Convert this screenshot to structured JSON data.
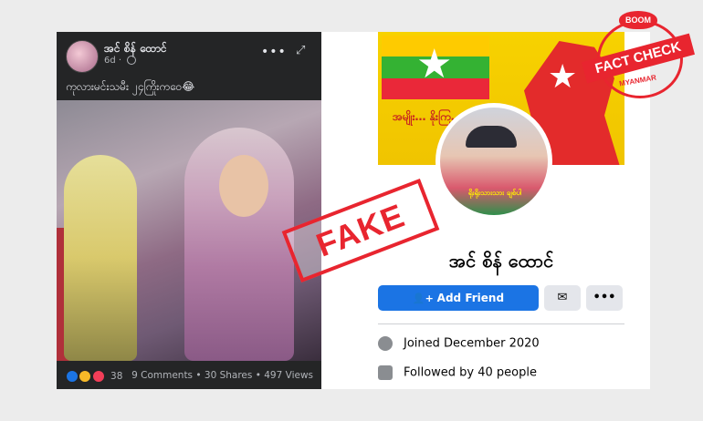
{
  "post": {
    "author": "အင် စိန် ထောင်",
    "time": "6d ·",
    "more": "•••",
    "expand": "⤢",
    "caption": "ကုလားမင်းသမီး ၂၄ကြိုးကဝေ😂",
    "reaction_count": "38",
    "stats": "9 Comments • 30 Shares • 497 Views"
  },
  "profile": {
    "cover_text": "အမျိုး… နိုးကြ…",
    "pfp_text": "ရိုးရိုးသားသား ချစ်ပါ",
    "name": "အင် စိန် ထောင်",
    "add_friend": "Add Friend",
    "messenger_icon": "✉",
    "more": "•••",
    "joined": "Joined December 2020",
    "followed": "Followed by 40 people"
  },
  "stamps": {
    "fake": "FAKE",
    "boom": "BOOM",
    "fact_check": "FACT CHECK",
    "myanmar": "MYANMAR"
  },
  "colors": {
    "accent": "#1b74e4",
    "stamp_red": "#e8252f",
    "dark_bg": "#242526"
  }
}
